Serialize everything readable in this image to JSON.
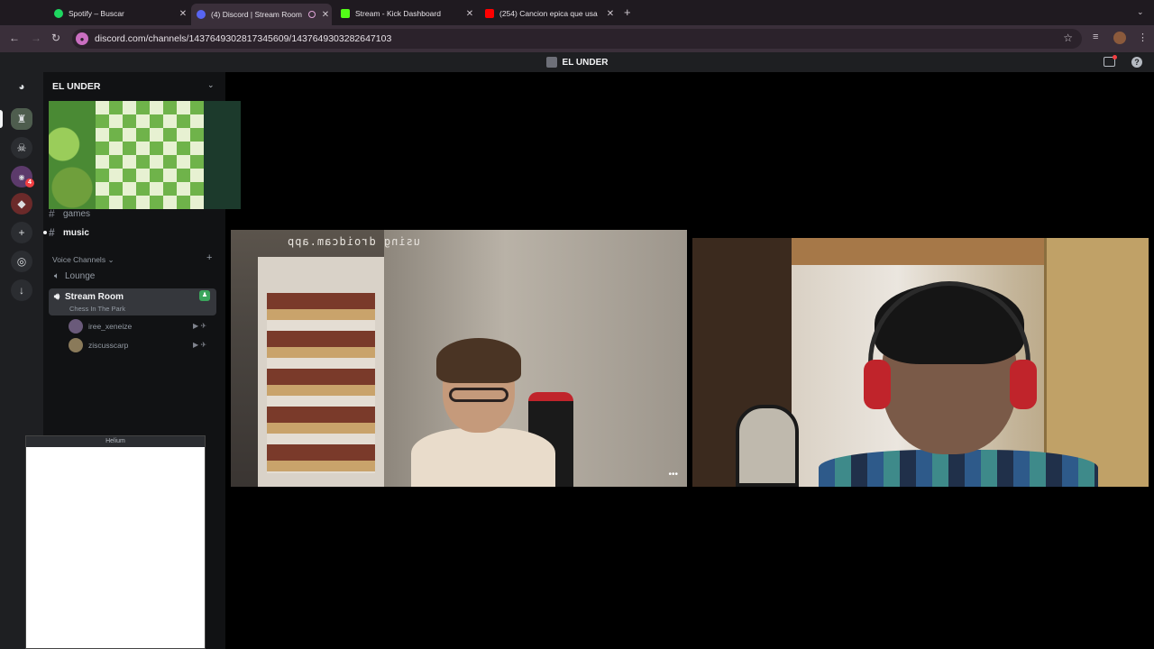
{
  "browser": {
    "tabs": [
      {
        "title": "Spotify – Buscar",
        "favicon_color": "#1ed760"
      },
      {
        "title": "(4) Discord | Stream Room",
        "favicon_color": "#5865f2"
      },
      {
        "title": "Stream - Kick Dashboard",
        "favicon_color": "#53fc18"
      },
      {
        "title": "(254) Cancion epica que usa",
        "favicon_color": "#ff0000"
      }
    ],
    "url": "discord.com/channels/1437649302817345609/1437649303282647103"
  },
  "discord": {
    "window_title": "EL UNDER",
    "server_name": "EL UNDER",
    "guild_badges": [
      "4"
    ],
    "channels": {
      "games": "games",
      "music": "music"
    },
    "voice_category": "Voice Channels",
    "voice_channels": [
      {
        "name": "Lounge"
      },
      {
        "name": "Stream Room",
        "activity": "Chess In The Park"
      }
    ],
    "voice_users": [
      {
        "name": "iree_xeneize"
      },
      {
        "name": "ziscusscarp"
      }
    ]
  },
  "helium_window": {
    "title": "Helium"
  },
  "streams": {
    "watermark": "using droidcam.app"
  }
}
